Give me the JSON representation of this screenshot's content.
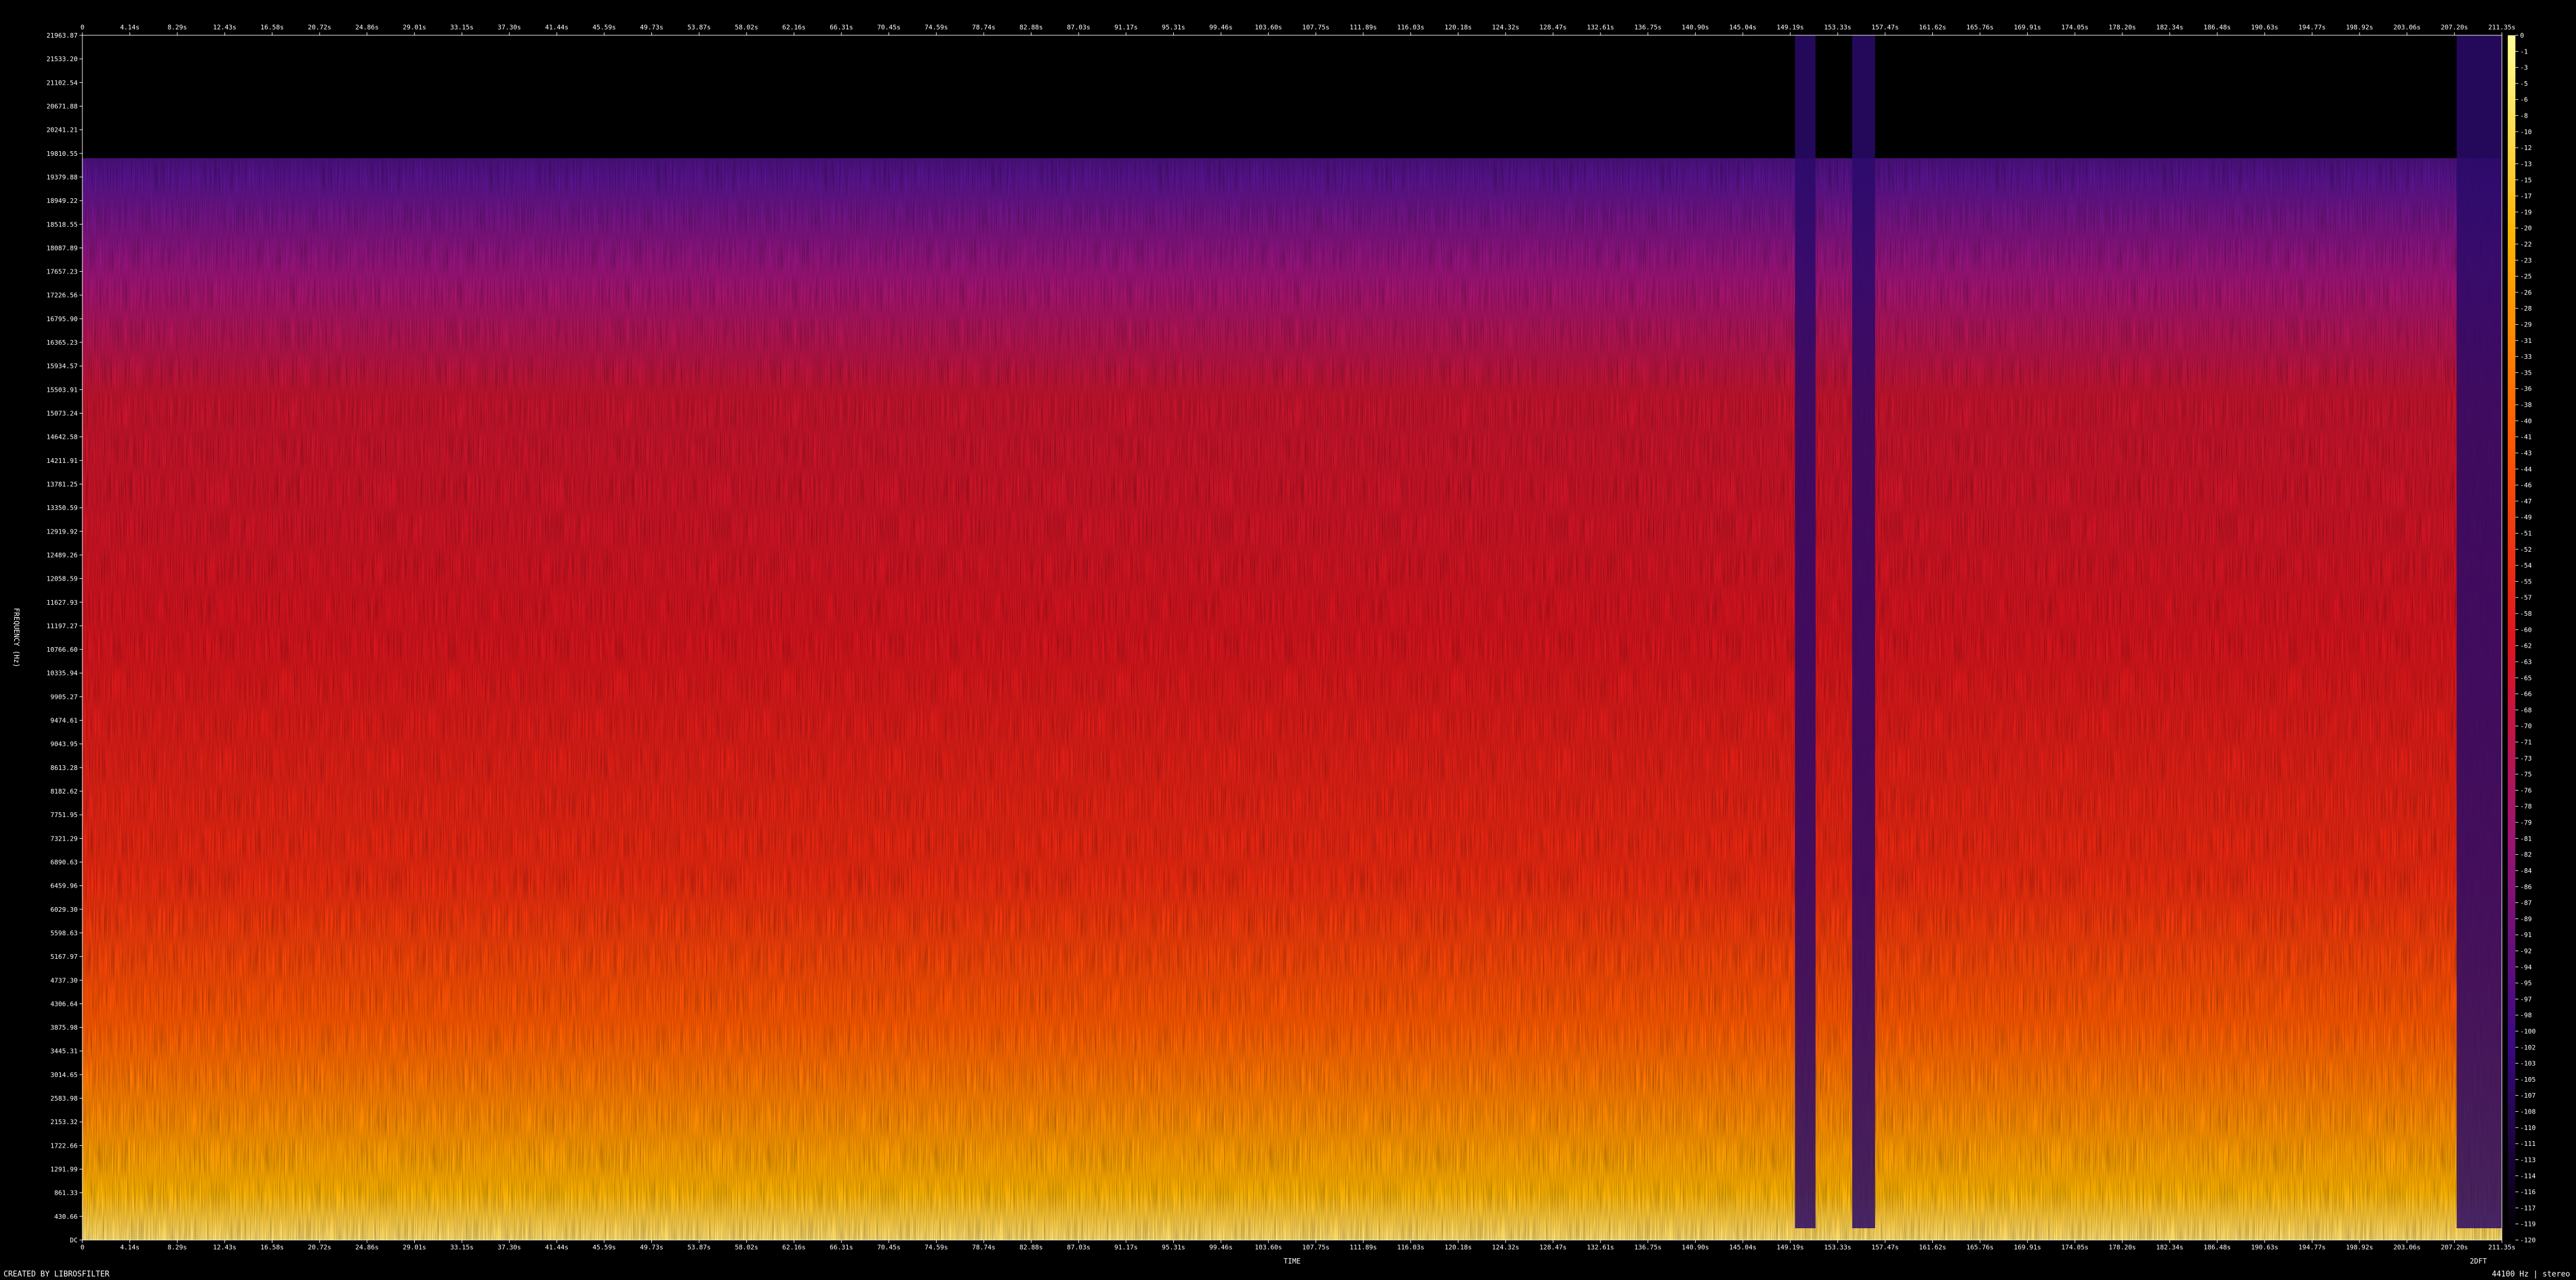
{
  "chart_data": {
    "type": "heatmap",
    "title": "",
    "xlabel": "TIME",
    "ylabel": "FREQUENCY (Hz)",
    "x_ticks": [
      "0",
      "4.14s",
      "8.29s",
      "12.43s",
      "16.58s",
      "20.72s",
      "24.86s",
      "29.01s",
      "33.15s",
      "37.30s",
      "41.44s",
      "45.59s",
      "49.73s",
      "53.87s",
      "58.02s",
      "62.16s",
      "66.31s",
      "70.45s",
      "74.59s",
      "78.74s",
      "82.88s",
      "87.03s",
      "91.17s",
      "95.31s",
      "99.46s",
      "103.60s",
      "107.75s",
      "111.89s",
      "116.03s",
      "120.18s",
      "124.32s",
      "128.47s",
      "132.61s",
      "136.75s",
      "140.90s",
      "145.04s",
      "149.19s",
      "153.33s",
      "157.47s",
      "161.62s",
      "165.76s",
      "169.91s",
      "174.05s",
      "178.20s",
      "182.34s",
      "186.48s",
      "190.63s",
      "194.77s",
      "198.92s",
      "203.06s",
      "207.20s",
      "211.35s"
    ],
    "y_ticks": [
      "21963.87",
      "21533.20",
      "21102.54",
      "20671.88",
      "20241.21",
      "19810.55",
      "19379.88",
      "18949.22",
      "18518.55",
      "18087.89",
      "17657.23",
      "17226.56",
      "16795.90",
      "16365.23",
      "15934.57",
      "15503.91",
      "15073.24",
      "14642.58",
      "14211.91",
      "13781.25",
      "13350.59",
      "12919.92",
      "12489.26",
      "12058.59",
      "11627.93",
      "11197.27",
      "10766.60",
      "10335.94",
      "9905.27",
      "9474.61",
      "9043.95",
      "8613.28",
      "8182.62",
      "7751.95",
      "7321.29",
      "6890.63",
      "6459.96",
      "6029.30",
      "5598.63",
      "5167.97",
      "4737.30",
      "4306.64",
      "3875.98",
      "3445.31",
      "3014.65",
      "2583.98",
      "2153.32",
      "1722.66",
      "1291.99",
      "861.33",
      "430.66",
      "DC"
    ],
    "colorbar_ticks": [
      "0",
      "-1",
      "-3",
      "-5",
      "-6",
      "-8",
      "-10",
      "-12",
      "-13",
      "-15",
      "-17",
      "-19",
      "-20",
      "-22",
      "-23",
      "-25",
      "-26",
      "-28",
      "-29",
      "-31",
      "-33",
      "-35",
      "-36",
      "-38",
      "-40",
      "-41",
      "-43",
      "-44",
      "-46",
      "-47",
      "-49",
      "-51",
      "-52",
      "-54",
      "-55",
      "-57",
      "-58",
      "-60",
      "-62",
      "-63",
      "-65",
      "-66",
      "-68",
      "-70",
      "-71",
      "-73",
      "-75",
      "-76",
      "-78",
      "-79",
      "-81",
      "-82",
      "-84",
      "-86",
      "-87",
      "-89",
      "-91",
      "-92",
      "-94",
      "-95",
      "-97",
      "-98",
      "-100",
      "-102",
      "-103",
      "-105",
      "-107",
      "-108",
      "-110",
      "-111",
      "-113",
      "-114",
      "-116",
      "-117",
      "-119",
      "-120"
    ],
    "x_range": [
      0,
      211.35
    ],
    "y_range": [
      0,
      22050
    ],
    "color_range_db": [
      -120,
      0
    ],
    "colormap": [
      "#000000",
      "#3a0a82",
      "#9a1470",
      "#e0141e",
      "#ff5a00",
      "#ffb400",
      "#ffff96"
    ],
    "energy_profile": {
      "cutoff_hz": 19800,
      "quiet_regions_s": [
        [
          149.6,
          151.4
        ],
        [
          154.6,
          156.6
        ],
        [
          207.4,
          211.35
        ]
      ]
    }
  },
  "footer": {
    "credit": "CREATED BY LIBROSFILTER",
    "x_axis_label": "TIME",
    "secondary_label": "2DFT",
    "sample_info": "44100 Hz | stereo"
  },
  "colors": {
    "background": "#000000",
    "text": "#ffffff"
  }
}
